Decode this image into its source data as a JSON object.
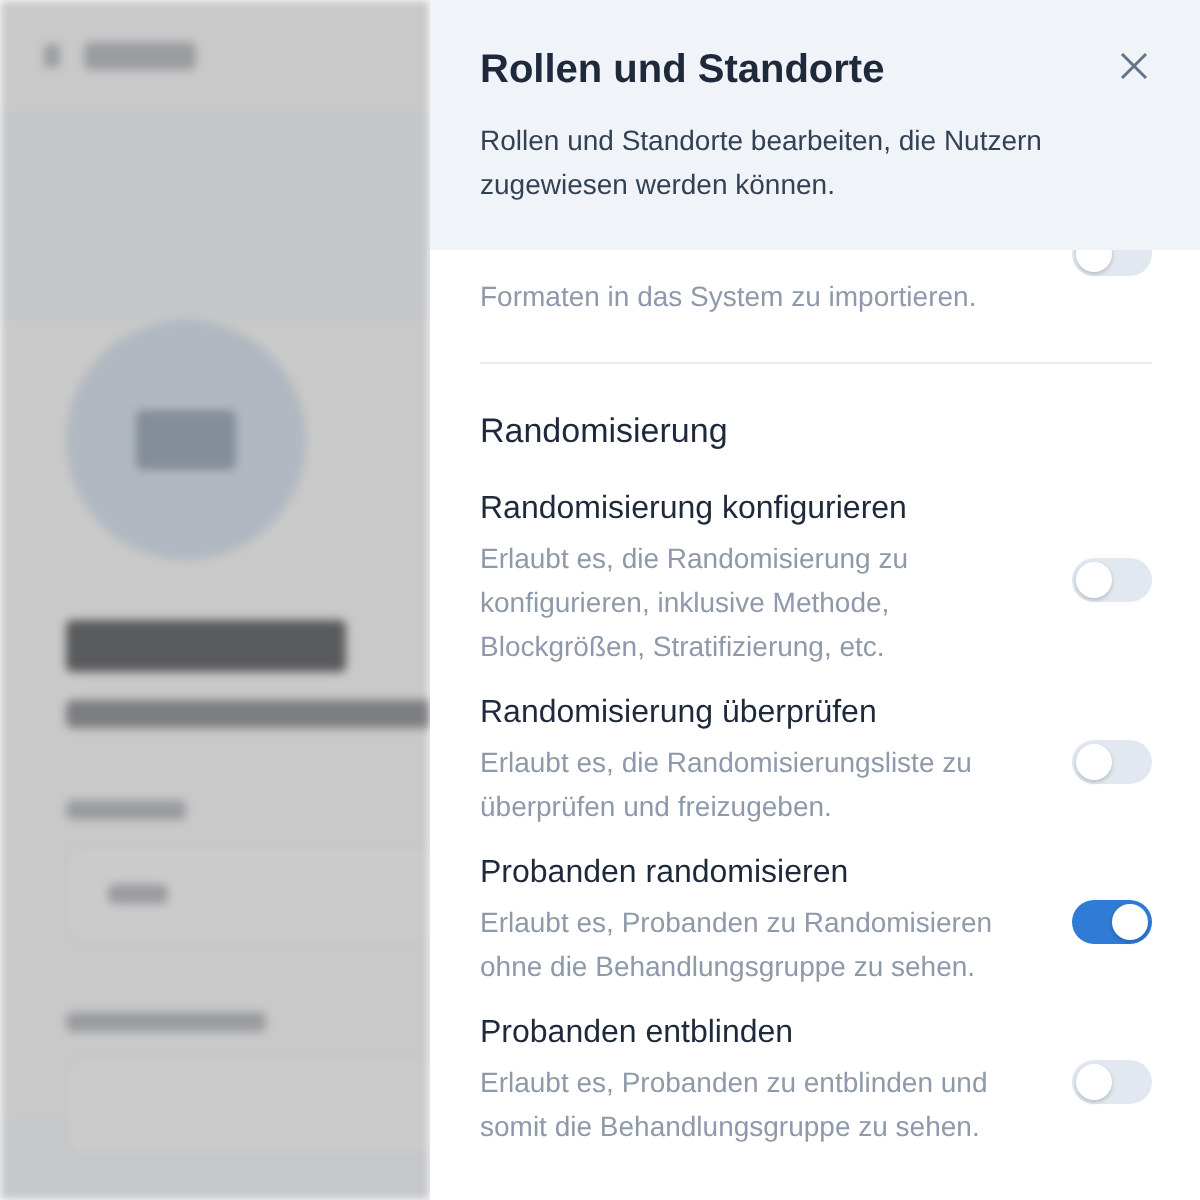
{
  "panel": {
    "title": "Rollen und Standorte",
    "description": "Rollen und Standorte bearbeiten, die Nutzern zugewiesen werden können.",
    "sections": [
      {
        "permissions": [
          {
            "description": "Formaten in das System zu importieren.",
            "on": false
          }
        ]
      },
      {
        "title": "Randomisierung",
        "permissions": [
          {
            "title": "Randomisierung konfigurieren",
            "description": "Erlaubt es, die Randomisierung zu konfigurieren, inklusive Methode, Blockgrößen, Stratifizierung, etc.",
            "on": false
          },
          {
            "title": "Randomisierung überprüfen",
            "description": "Erlaubt es, die Randomisierungsliste zu überprüfen und freizugeben.",
            "on": false
          },
          {
            "title": "Probanden randomisieren",
            "description": "Erlaubt es, Probanden zu Randomisieren ohne die Behandlungsgruppe zu sehen.",
            "on": true
          },
          {
            "title": "Probanden entblinden",
            "description": "Erlaubt es, Probanden zu entblinden und somit die Behandlungsgruppe zu sehen.",
            "on": false
          }
        ]
      }
    ]
  }
}
